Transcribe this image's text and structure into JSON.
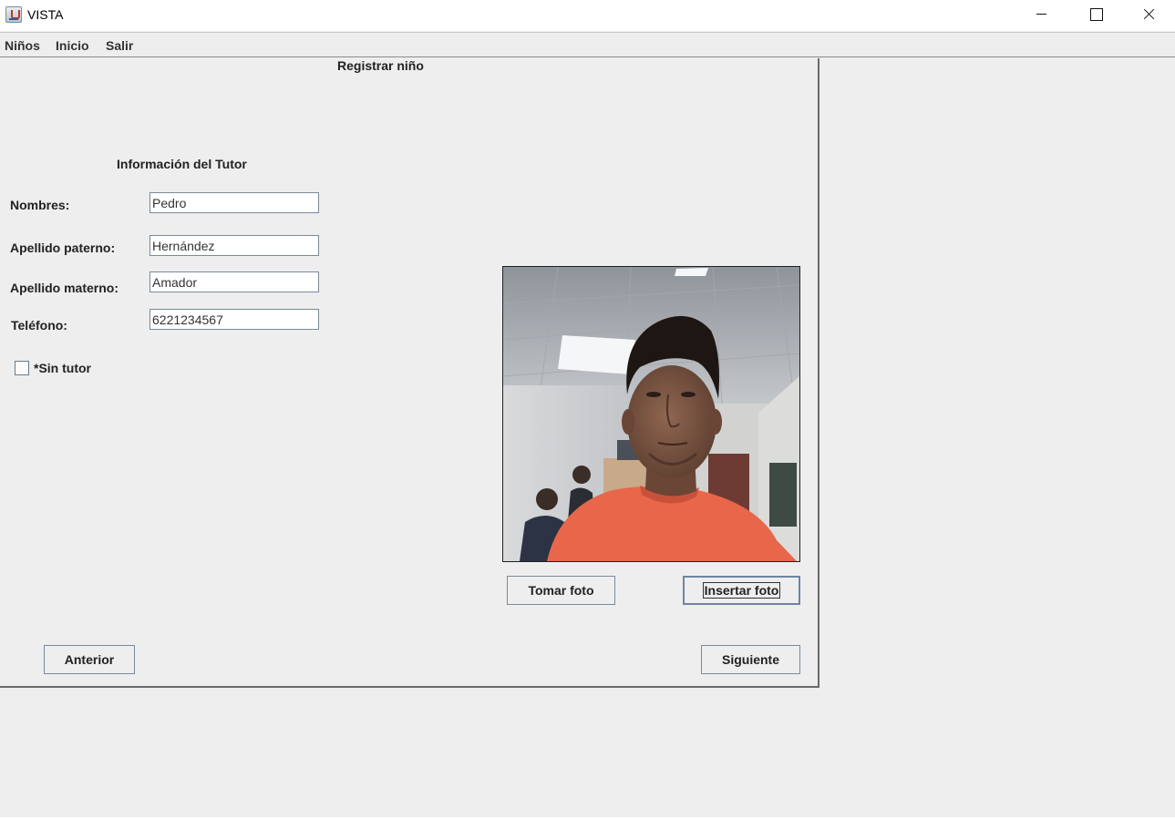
{
  "window": {
    "title": "VISTA",
    "icon": "java-cup-icon"
  },
  "menu": {
    "items": [
      "Niños",
      "Inicio",
      "Salir"
    ]
  },
  "form": {
    "title": "Registrar niño",
    "section_title": "Información del Tutor",
    "fields": {
      "nombres": {
        "label": "Nombres:",
        "value": "Pedro"
      },
      "apellido_paterno": {
        "label": "Apellido paterno:",
        "value": "Hernández"
      },
      "apellido_materno": {
        "label": "Apellido materno:",
        "value": "Amador"
      },
      "telefono": {
        "label": "Teléfono:",
        "value": "6221234567"
      }
    },
    "sin_tutor": {
      "label": "*Sin tutor",
      "checked": false
    }
  },
  "photo": {
    "take_label": "Tomar foto",
    "insert_label": "Insertar foto"
  },
  "navigation": {
    "prev_label": "Anterior",
    "next_label": "Siguiente"
  }
}
